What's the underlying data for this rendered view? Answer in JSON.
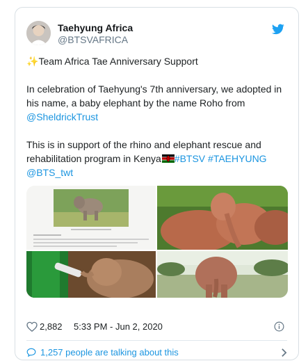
{
  "tweet": {
    "display_name": "Taehyung Africa",
    "handle": "@BTSVAFRICA",
    "title_line": "Team Africa Tae Anniversary Support",
    "para1": "In celebration of Taehyung's 7th anniversary, we adopted in his name, a baby elephant by the name Roho from ",
    "para1_mention": "@SheldrickTrust",
    "para2": "This is in support of the rhino and elephant rescue and rehabilitation program in Kenya",
    "hashtag1": "#BTSV",
    "hashtag2": "#TAEHYUNG",
    "mention2": "@BTS_twt",
    "like_count": "2,882",
    "timestamp": "5:33 PM - Jun 2, 2020",
    "talking": "1,257 people are talking about this"
  },
  "icons": {
    "brand": "twitter-bird-icon",
    "like": "heart-icon",
    "info": "info-icon",
    "comment": "comment-icon",
    "chevron": "chevron-right-icon",
    "sparkle": "sparkles-icon",
    "flag": "kenya-flag-icon"
  },
  "colors": {
    "link": "#1b95e0",
    "text": "#1c2022",
    "muted": "#657786",
    "border": "#d8dfe4"
  }
}
